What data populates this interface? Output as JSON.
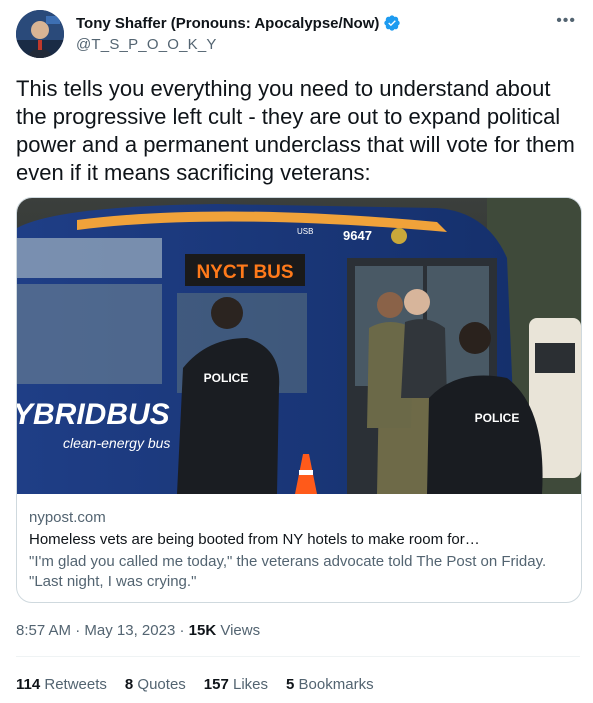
{
  "author": {
    "name": "Tony Shaffer (Pronouns: Apocalypse/Now)",
    "handle": "@T_S_P_O_O_K_Y"
  },
  "more_icon": "more-horizontal-icon",
  "verified_icon": "verified-badge-icon",
  "tweet": {
    "text": "This tells you everything you need to understand about the progressive left cult - they are out to expand political power and a permanent underclass that will vote for them even if it means sacrificing veterans:"
  },
  "card": {
    "image_texts": {
      "bus_sign": "NYCT BUS",
      "bus_number": "9647",
      "usb_label": "USB",
      "hybrid_label": "YBRIDBUS",
      "clean_energy": "clean-energy bus",
      "police_left": "POLICE",
      "police_right": "POLICE"
    },
    "domain": "nypost.com",
    "title": "Homeless vets are being booted from NY hotels to make room for…",
    "description": "\"I'm glad you called me today,\" the veterans advocate told The Post on Friday. \"Last night, I was crying.\""
  },
  "meta": {
    "time": "8:57 AM",
    "date": "May 13, 2023",
    "views_count": "15K",
    "views_label": "Views"
  },
  "stats": [
    {
      "count": "114",
      "label": "Retweets"
    },
    {
      "count": "8",
      "label": "Quotes"
    },
    {
      "count": "157",
      "label": "Likes"
    },
    {
      "count": "5",
      "label": "Bookmarks"
    }
  ],
  "colors": {
    "verified": "#1d9bf0",
    "text_primary": "#0f1419",
    "text_secondary": "#536471",
    "border": "#cfd9de"
  }
}
